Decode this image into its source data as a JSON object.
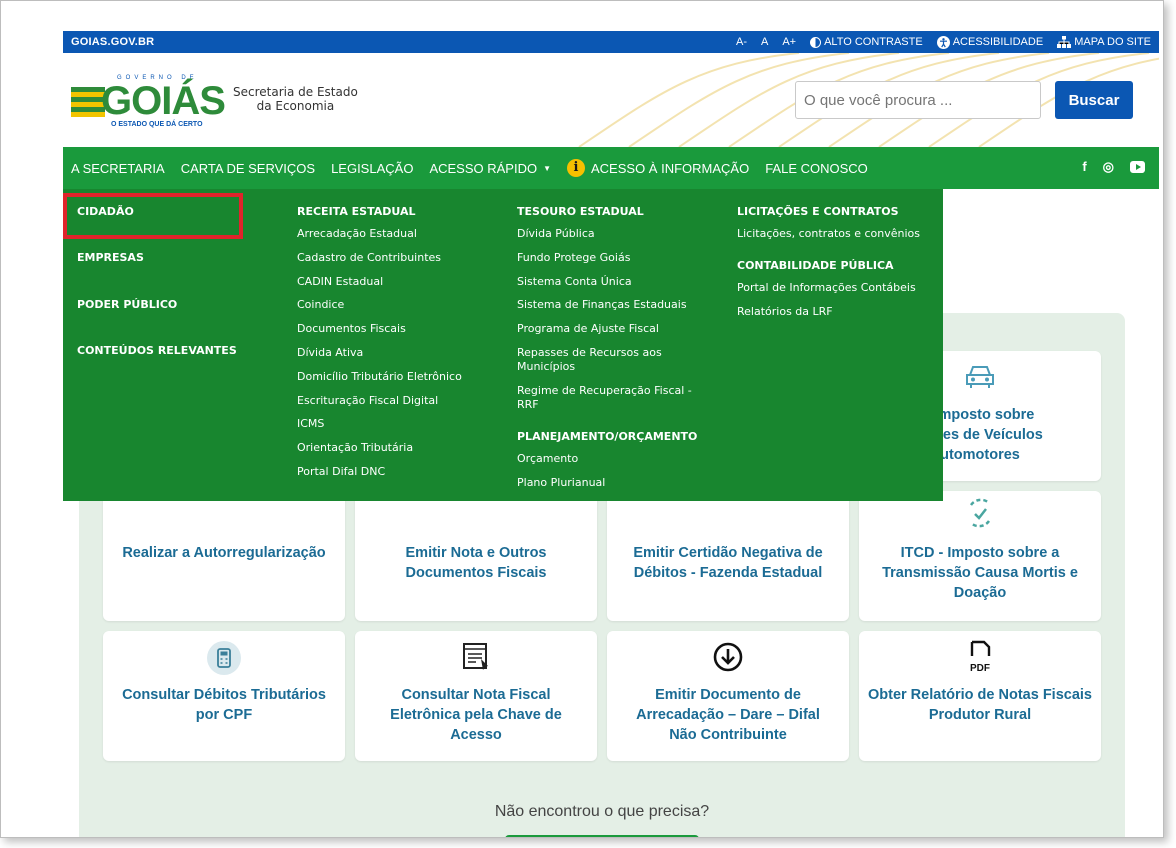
{
  "topbar": {
    "site": "GOIAS.GOV.BR",
    "font_small": "A-",
    "font_normal": "A",
    "font_large": "A+",
    "contrast": "ALTO CONTRASTE",
    "accessibility": "ACESSIBILIDADE",
    "sitemap": "MAPA DO SITE"
  },
  "header": {
    "logo_top": "GOVERNO DE",
    "logo_main": "GOIÁS",
    "logo_tagline": "O ESTADO QUE DÁ CERTO",
    "secretaria_line1": "Secretaria de Estado",
    "secretaria_line2": "da Economia",
    "search_placeholder": "O que você procura ...",
    "search_button": "Buscar"
  },
  "nav": {
    "items": [
      "A SECRETARIA",
      "CARTA DE SERVIÇOS",
      "LEGISLAÇÃO",
      "ACESSO RÁPIDO",
      "ACESSO À INFORMAÇÃO",
      "FALE CONOSCO"
    ],
    "social": [
      "f",
      "◎"
    ]
  },
  "mega": {
    "left": [
      "CIDADÃO",
      "EMPRESAS",
      "PODER PÚBLICO",
      "CONTEÚDOS RELEVANTES"
    ],
    "receita": {
      "title": "RECEITA ESTADUAL",
      "links": [
        "Arrecadação Estadual",
        "Cadastro de Contribuintes",
        "CADIN Estadual",
        "Coindice",
        "Documentos Fiscais",
        "Dívida Ativa",
        "Domicílio Tributário Eletrônico",
        "Escrituração Fiscal Digital",
        "ICMS",
        "Orientação Tributária",
        "Portal Difal DNC"
      ]
    },
    "tesouro": {
      "title": "TESOURO ESTADUAL",
      "links": [
        "Dívida Pública",
        "Fundo Protege Goiás",
        "Sistema Conta Única",
        "Sistema de Finanças Estaduais",
        "Programa de Ajuste Fiscal",
        "Repasses de Recursos aos Municípios",
        "Regime de Recuperação Fiscal - RRF"
      ]
    },
    "planejamento": {
      "title": "PLANEJAMENTO/ORÇAMENTO",
      "links": [
        "Orçamento",
        "Plano Plurianual"
      ]
    },
    "licitacoes": {
      "title": "LICITAÇÕES E CONTRATOS",
      "links": [
        "Licitações, contratos e convênios"
      ]
    },
    "contabilidade": {
      "title": "CONTABILIDADE PÚBLICA",
      "links": [
        "Portal de Informações Contábeis",
        "Relatórios da LRF"
      ]
    }
  },
  "cards": {
    "ipva": "- Imposto sobre\ndades de Veículos\nutomotores",
    "autorreg": "Realizar a Autorregularização",
    "emitir_nota": "Emitir Nota e Outros Documentos Fiscais",
    "certidao": "Emitir Certidão Negativa de Débitos - Fazenda Estadual",
    "itcd": "ITCD - Imposto sobre a Transmissão Causa Mortis e Doação",
    "debitos_cpf": "Consultar Débitos Tributários por CPF",
    "nota_chave": "Consultar Nota Fiscal Eletrônica pela Chave de Acesso",
    "dare": "Emitir Documento de Arrecadação – Dare – Difal Não Contribuinte",
    "relatorio": "Obter Relatório de Notas Fiscais Produtor Rural",
    "pdf_label": "PDF"
  },
  "footer": {
    "not_found": "Não encontrou o que precisa?"
  },
  "colors": {
    "blue": "#0b57b3",
    "green": "#1a9a3c",
    "mega_green": "#18862f",
    "card_text": "#1b6b94",
    "highlight": "#e0242b"
  }
}
